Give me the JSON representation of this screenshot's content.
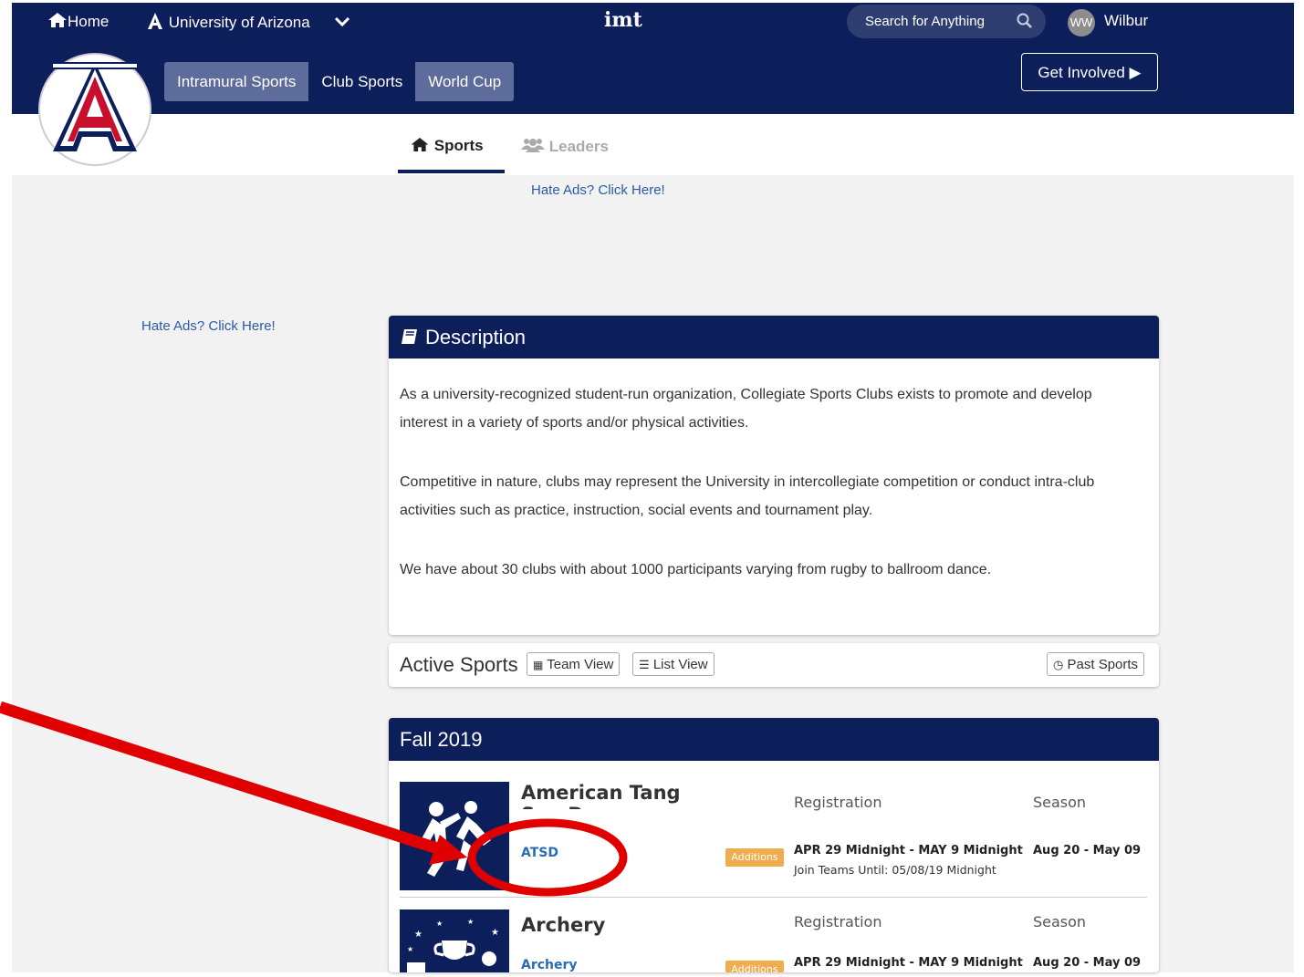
{
  "topnav": {
    "home_label": "Home",
    "school_label": "University of Arizona",
    "brand_glyph": "imt",
    "search_placeholder": "Search for Anything",
    "user_initials": "WW",
    "user_name": "Wilbur"
  },
  "tabs": [
    "Intramural Sports",
    "Club Sports",
    "World Cup"
  ],
  "get_involved_label": "Get Involved ▶",
  "subnav": {
    "sports_label": "Sports",
    "leaders_label": "Leaders"
  },
  "ads": {
    "top_link": "Hate Ads? Click Here!",
    "side_link": "Hate Ads? Click Here!"
  },
  "description": {
    "title": "Description",
    "p1": "As a university-recognized student-run organization, Collegiate Sports Clubs exists to promote and develop interest in a variety of sports and/or physical activities.",
    "p2": "Competitive in nature, clubs may represent the University in intercollegiate competition or conduct intra-club activities such as practice, instruction, social events and tournament play.",
    "p3": "We have about 30 clubs with about 1000 participants varying from rugby to ballroom dance."
  },
  "active_sports": {
    "title": "Active Sports",
    "team_view": "Team View",
    "list_view": "List View",
    "past_sports": "Past Sports"
  },
  "season": {
    "title": "Fall 2019",
    "sports": [
      {
        "name": "American Tang Soo Do",
        "abbr": "ATSD",
        "badge": "Additions",
        "registration_label": "Registration",
        "registration_value": "APR 29 Midnight - MAY 9 Midnight",
        "join_teams": "Join Teams Until: 05/08/19 Midnight",
        "season_label": "Season",
        "season_value": "Aug 20 - May 09"
      },
      {
        "name": "Archery",
        "abbr": "Archery",
        "badge": "Additions",
        "registration_label": "Registration",
        "registration_value": "APR 29 Midnight - MAY 9 Midnight",
        "season_label": "Season",
        "season_value": "Aug 20 - May 09"
      }
    ]
  },
  "colors": {
    "navy": "#0d1f5b",
    "link": "#2a5aa8",
    "badge": "#f0ad4e",
    "annotation": "#e00000"
  }
}
